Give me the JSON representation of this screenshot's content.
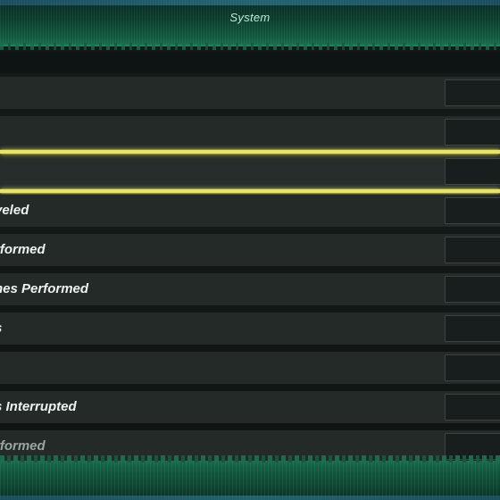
{
  "header": {
    "title": "System"
  },
  "stats": {
    "rows": [
      {
        "label": "",
        "value": ""
      },
      {
        "label": "",
        "value": ""
      },
      {
        "label": "",
        "value": ""
      },
      {
        "label": "veled",
        "value": ""
      },
      {
        "label": "rformed",
        "value": ""
      },
      {
        "label": "nes Performed",
        "value": ""
      },
      {
        "label": "s",
        "value": ""
      },
      {
        "label": "",
        "value": ""
      },
      {
        "label": "s Interrupted",
        "value": ""
      },
      {
        "label": "rformed",
        "value": ""
      }
    ]
  },
  "colors": {
    "selection_highlight": "#e8e36a",
    "header_green": "#145a40",
    "row_background": "#232a28"
  }
}
